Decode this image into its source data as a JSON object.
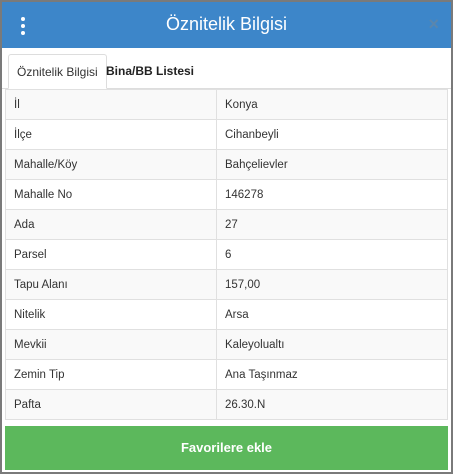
{
  "header": {
    "title": "Öznitelik Bilgisi",
    "close_label": "×"
  },
  "tabs": [
    {
      "label": "Öznitelik Bilgisi",
      "active": true
    },
    {
      "label": "Bina/BB Listesi",
      "active": false
    }
  ],
  "rows": [
    {
      "key": "İl",
      "value": "Konya"
    },
    {
      "key": "İlçe",
      "value": "Cihanbeyli"
    },
    {
      "key": "Mahalle/Köy",
      "value": "Bahçelievler"
    },
    {
      "key": "Mahalle No",
      "value": "146278"
    },
    {
      "key": "Ada",
      "value": "27"
    },
    {
      "key": "Parsel",
      "value": "6"
    },
    {
      "key": "Tapu Alanı",
      "value": "157,00"
    },
    {
      "key": "Nitelik",
      "value": "Arsa"
    },
    {
      "key": "Mevkii",
      "value": "Kaleyolualtı"
    },
    {
      "key": "Zemin Tip",
      "value": "Ana Taşınmaz"
    },
    {
      "key": "Pafta",
      "value": "26.30.N"
    }
  ],
  "footer": {
    "favorite_label": "Favorilere ekle"
  },
  "colors": {
    "header": "#3d86c9",
    "button": "#5cb85c"
  }
}
